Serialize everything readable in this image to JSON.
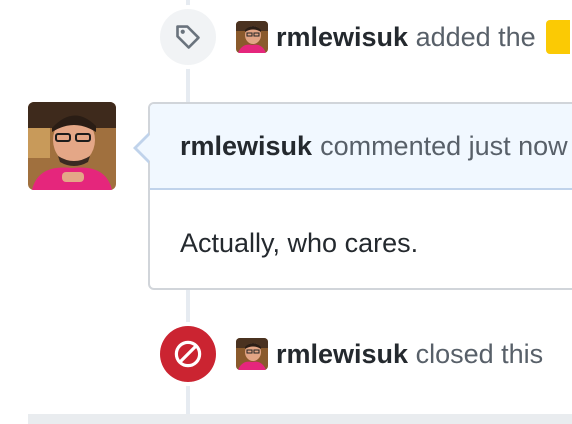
{
  "timeline": {
    "label_event": {
      "author": "rmlewisuk",
      "action": "added the",
      "icon": "tag-icon",
      "label_color": "#fbca04"
    },
    "comment": {
      "author": "rmlewisuk",
      "meta": "commented just now",
      "body": "Actually, who cares."
    },
    "closed_event": {
      "author": "rmlewisuk",
      "action": "closed this",
      "icon": "circle-slash-icon",
      "badge_color": "#cb2431"
    }
  },
  "colors": {
    "timeline_line": "#e6ebf1",
    "comment_header_bg": "#f1f8ff",
    "comment_border": "#d1d5da",
    "author_text": "#24292e",
    "muted_text": "#586069"
  }
}
